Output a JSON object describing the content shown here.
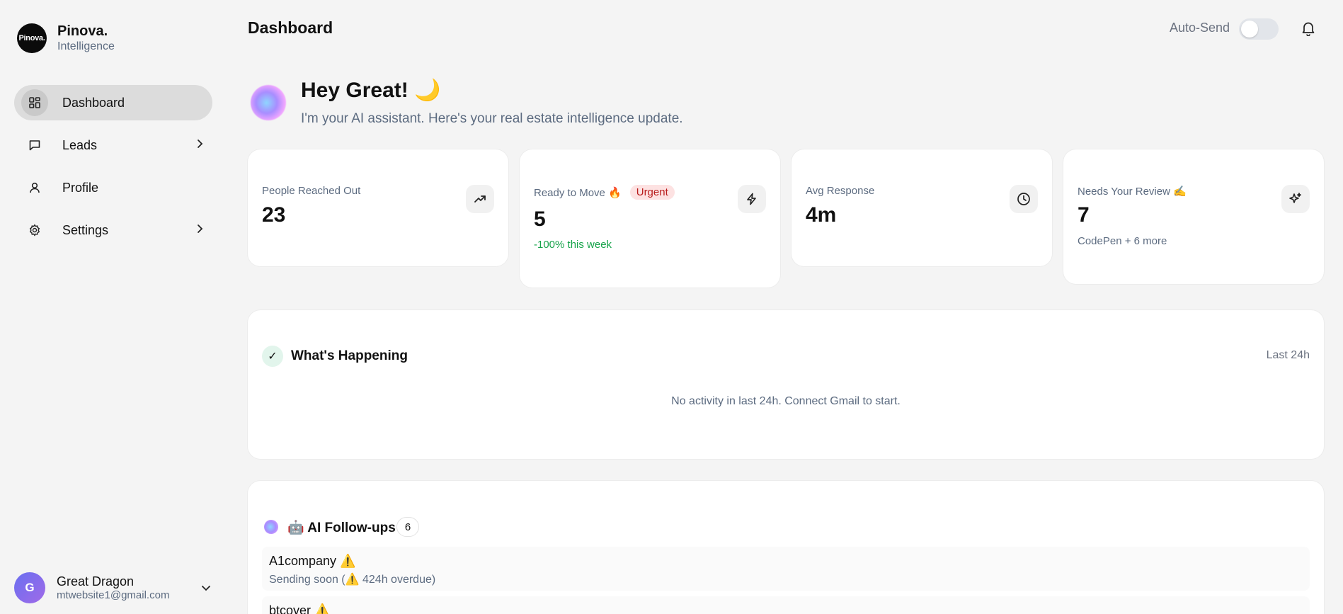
{
  "brand": {
    "logo_text": "Pinova.",
    "name": "Pinova.",
    "subtitle": "Intelligence"
  },
  "sidebar": {
    "items": [
      {
        "label": "Dashboard",
        "icon": "grid-icon",
        "active": true
      },
      {
        "label": "Leads",
        "icon": "chat-icon",
        "has_chevron": true
      },
      {
        "label": "Profile",
        "icon": "user-icon"
      },
      {
        "label": "Settings",
        "icon": "gear-icon",
        "has_chevron": true
      }
    ]
  },
  "user": {
    "initial": "G",
    "name": "Great Dragon",
    "email": "mtwebsite1@gmail.com"
  },
  "header": {
    "title": "Dashboard",
    "auto_send_label": "Auto-Send",
    "auto_send_on": false
  },
  "hero": {
    "title": "Hey Great! 🌙",
    "subtitle": "I'm your AI assistant. Here's your real estate intelligence update."
  },
  "stats": [
    {
      "label": "People Reached Out",
      "value": "23",
      "icon": "trend-up-icon"
    },
    {
      "label": "Ready to Move 🔥",
      "badge": "Urgent",
      "value": "5",
      "sub": "-100% this week",
      "sub_color": "#16a34a",
      "icon": "bolt-icon"
    },
    {
      "label": "Avg Response",
      "value": "4m",
      "icon": "clock-icon"
    },
    {
      "label": "Needs Your Review ✍️",
      "value": "7",
      "sub": "CodePen + 6 more",
      "sub_color": "#5c6b80",
      "icon": "sparkle-icon"
    }
  ],
  "happening": {
    "title": "What's Happening",
    "check": "✓",
    "range": "Last 24h",
    "empty": "No activity in last 24h. Connect Gmail to start."
  },
  "followups": {
    "title": "🤖 AI Follow-ups",
    "count": "6",
    "items": [
      {
        "name": "A1company ⚠️",
        "status": "Sending soon (⚠️ 424h overdue)"
      },
      {
        "name": "btcoyer ⚠️",
        "status": ""
      }
    ]
  },
  "colors": {
    "accent": "#6a6ff0",
    "urgent_bg": "#fde2e2",
    "urgent_text": "#b91c1c",
    "positive": "#16a34a"
  }
}
